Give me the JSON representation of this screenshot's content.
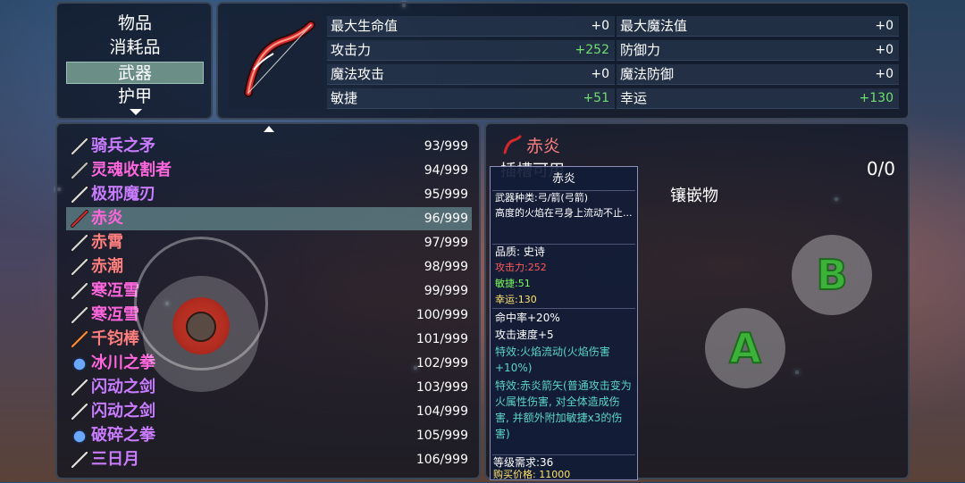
{
  "categories": {
    "items": [
      {
        "label": "物品",
        "selected": false
      },
      {
        "label": "消耗品",
        "selected": false
      },
      {
        "label": "武器",
        "selected": true
      },
      {
        "label": "护甲",
        "selected": false
      }
    ]
  },
  "weapon_icon": "bow-icon",
  "stats": [
    {
      "label": "最大生命值",
      "value": "+0",
      "positive": false
    },
    {
      "label": "最大魔法值",
      "value": "+0",
      "positive": false
    },
    {
      "label": "攻击力",
      "value": "+252",
      "positive": true
    },
    {
      "label": "防御力",
      "value": "+0",
      "positive": false
    },
    {
      "label": "魔法攻击",
      "value": "+0",
      "positive": false
    },
    {
      "label": "魔法防御",
      "value": "+0",
      "positive": false
    },
    {
      "label": "敏捷",
      "value": "+51",
      "positive": true
    },
    {
      "label": "幸运",
      "value": "+130",
      "positive": true
    }
  ],
  "items": [
    {
      "name": "骑兵之矛",
      "count": "93/999",
      "color": "#c97cff",
      "icon": "spear-icon",
      "selected": false
    },
    {
      "name": "灵魂收割者",
      "count": "94/999",
      "color": "#ff66dd",
      "icon": "scythe-icon",
      "selected": false
    },
    {
      "name": "极邪魔刃",
      "count": "95/999",
      "color": "#c97cff",
      "icon": "sword-icon",
      "selected": false
    },
    {
      "name": "赤炎",
      "count": "96/999",
      "color": "#ff66dd",
      "icon": "bow-icon",
      "selected": true
    },
    {
      "name": "赤霄",
      "count": "97/999",
      "color": "#ff7e7e",
      "icon": "spear-icon",
      "selected": false
    },
    {
      "name": "赤潮",
      "count": "98/999",
      "color": "#ff7e7e",
      "icon": "spear-icon",
      "selected": false
    },
    {
      "name": "寒冱雪",
      "count": "99/999",
      "color": "#ff66dd",
      "icon": "spear-icon",
      "selected": false
    },
    {
      "name": "寒冱雪",
      "count": "100/999",
      "color": "#ff66dd",
      "icon": "spear-icon",
      "selected": false
    },
    {
      "name": "千钧棒",
      "count": "101/999",
      "color": "#ff7e7e",
      "icon": "staff-icon",
      "selected": false
    },
    {
      "name": "冰川之拳",
      "count": "102/999",
      "color": "#ff66dd",
      "icon": "gauntlet-icon",
      "selected": false
    },
    {
      "name": "闪动之剑",
      "count": "103/999",
      "color": "#c97cff",
      "icon": "sword-icon",
      "selected": false
    },
    {
      "name": "闪动之剑",
      "count": "104/999",
      "color": "#c97cff",
      "icon": "sword-icon",
      "selected": false
    },
    {
      "name": "破碎之拳",
      "count": "105/999",
      "color": "#c97cff",
      "icon": "gauntlet-icon",
      "selected": false
    },
    {
      "name": "三日月",
      "count": "106/999",
      "color": "#c97cff",
      "icon": "sword-icon",
      "selected": false
    }
  ],
  "detail": {
    "title": "赤炎",
    "title_icon": "bow-icon",
    "socket_label": "插槽可用",
    "socket_count": "0/0",
    "inlay_label": "镶嵌物"
  },
  "tooltip": {
    "title": "赤炎",
    "weapon_type": "武器种类:弓/箭(弓箭)",
    "description": "高度的火焰在弓身上流动不止...",
    "quality": "品质: 史诗",
    "attack": "攻击力:252",
    "agility": "敏捷:51",
    "luck": "幸运:130",
    "hit_rate": "命中率+20%",
    "attack_speed": "攻击速度+5",
    "effect1": "特效:火焰流动(火焰伤害+10%)",
    "effect2": "特效:赤炎箭矢(普通攻击变为火属性伤害, 对全体造成伤害, 并额外附加敏捷x3的伤害)",
    "level_req": "等级需求:36",
    "price": "购买价格: 11000"
  },
  "controls": {
    "button_a": "A",
    "button_b": "B",
    "joystick_icon": "joystick-emblem-icon"
  },
  "colors": {
    "panel_border": "#3a4556",
    "positive_stat": "#6ee06e",
    "selection": "#6b8f86",
    "epic_pink": "#ff66dd",
    "purple": "#c97cff",
    "red": "#ff7e7e",
    "tooltip_red": "#ff5a5a",
    "tooltip_green": "#7cff5a",
    "tooltip_yellow": "#ffe46a",
    "tooltip_teal": "#5ad6c8",
    "button_green": "#3db23b"
  }
}
